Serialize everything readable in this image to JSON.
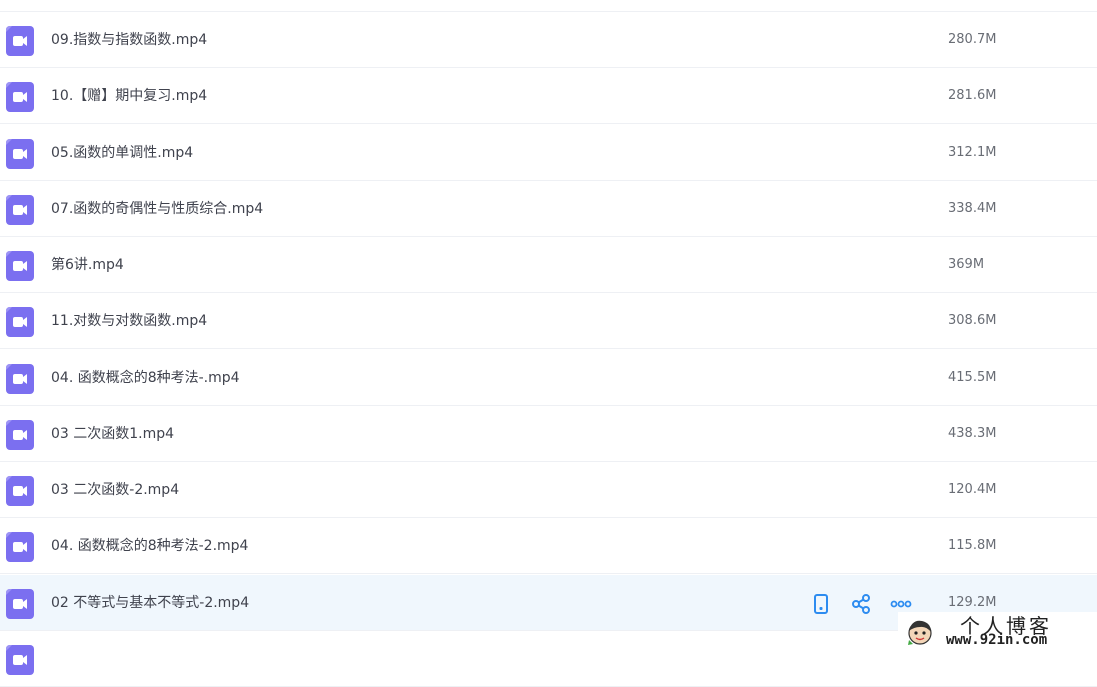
{
  "files": [
    {
      "name": "09.指数与指数函数.mp4",
      "size": "280.7M"
    },
    {
      "name": "10.【赠】期中复习.mp4",
      "size": "281.6M"
    },
    {
      "name": "05.函数的单调性.mp4",
      "size": "312.1M"
    },
    {
      "name": "07.函数的奇偶性与性质综合.mp4",
      "size": "338.4M"
    },
    {
      "name": "第6讲.mp4",
      "size": "369M"
    },
    {
      "name": "11.对数与对数函数.mp4",
      "size": "308.6M"
    },
    {
      "name": "04. 函数概念的8种考法-.mp4",
      "size": "415.5M"
    },
    {
      "name": "03 二次函数1.mp4",
      "size": "438.3M"
    },
    {
      "name": "03 二次函数-2.mp4",
      "size": "120.4M"
    },
    {
      "name": "04. 函数概念的8种考法-2.mp4",
      "size": "115.8M"
    },
    {
      "name": "02 不等式与基本不等式-2.mp4",
      "size": "129.2M",
      "selected": true
    }
  ],
  "row_actions": {
    "icons": [
      "phone-icon",
      "share-icon",
      "more-icon"
    ]
  },
  "watermark": {
    "title": "个人博客",
    "url": "www.92in.com"
  },
  "colors": {
    "file_icon": "#7b6ff0",
    "action_icon": "#2d8cf0",
    "selected_row": "#f0f7fd"
  }
}
